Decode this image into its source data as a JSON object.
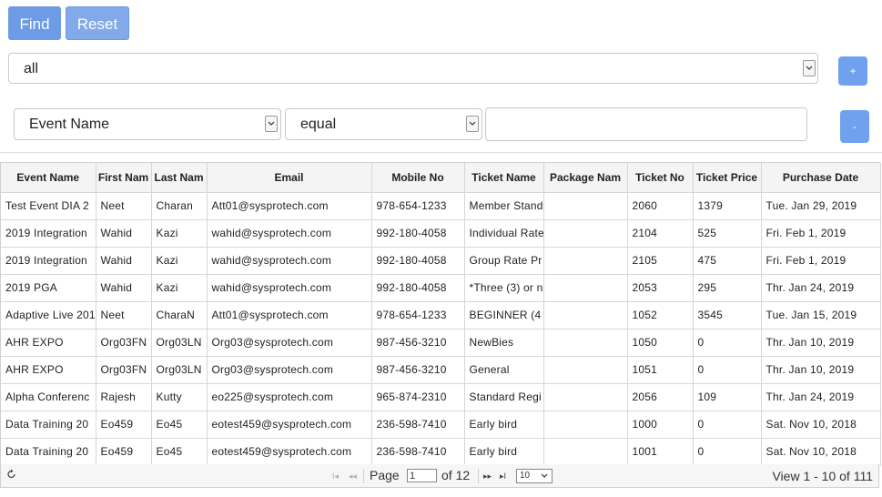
{
  "toolbar": {
    "find_label": "Find",
    "reset_label": "Reset",
    "plus_label": "+",
    "minus_label": "-"
  },
  "filter": {
    "group_value": "all",
    "field_value": "Event Name",
    "operator_value": "equal",
    "search_value": ""
  },
  "table": {
    "headers": [
      "Event Name",
      "First Nam",
      "Last Nam",
      "Email",
      "Mobile No",
      "Ticket Name",
      "Package Nam",
      "Ticket No",
      "Ticket Price",
      "Purchase Date"
    ],
    "rows": [
      [
        "Test Event DIA 2",
        "Neet",
        "Charan",
        "Att01@sysprotech.com",
        "978-654-1233",
        "Member Stand",
        "",
        "2060",
        "1379",
        "Tue. Jan 29, 2019"
      ],
      [
        "2019 Integration",
        "Wahid",
        "Kazi",
        "wahid@sysprotech.com",
        "992-180-4058",
        "Individual Rate",
        "",
        "2104",
        "525",
        "Fri. Feb 1, 2019"
      ],
      [
        "2019 Integration",
        "Wahid",
        "Kazi",
        "wahid@sysprotech.com",
        "992-180-4058",
        "Group Rate Pr",
        "",
        "2105",
        "475",
        "Fri. Feb 1, 2019"
      ],
      [
        "2019 PGA",
        "Wahid",
        "Kazi",
        "wahid@sysprotech.com",
        "992-180-4058",
        "*Three (3) or n",
        "",
        "2053",
        "295",
        "Thr. Jan 24, 2019"
      ],
      [
        "Adaptive Live 201",
        "Neet",
        "CharaN",
        "Att01@sysprotech.com",
        "978-654-1233",
        "BEGINNER (4",
        "",
        "1052",
        "3545",
        "Tue. Jan 15, 2019"
      ],
      [
        "AHR EXPO",
        "Org03FN",
        "Org03LN",
        "Org03@sysprotech.com",
        "987-456-3210",
        "NewBies",
        "",
        "1050",
        "0",
        "Thr. Jan 10, 2019"
      ],
      [
        "AHR EXPO",
        "Org03FN",
        "Org03LN",
        "Org03@sysprotech.com",
        "987-456-3210",
        "General",
        "",
        "1051",
        "0",
        "Thr. Jan 10, 2019"
      ],
      [
        "Alpha Conferenc",
        "Rajesh",
        "Kutty",
        "eo225@sysprotech.com",
        "965-874-2310",
        "Standard Regi",
        "",
        "2056",
        "109",
        "Thr. Jan 24, 2019"
      ],
      [
        "Data Training 20",
        "Eo459",
        "Eo45",
        "eotest459@sysprotech.com",
        "236-598-7410",
        "Early bird",
        "",
        "1000",
        "0",
        "Sat. Nov 10, 2018"
      ],
      [
        "Data Training 20",
        "Eo459",
        "Eo45",
        "eotest459@sysprotech.com",
        "236-598-7410",
        "Early bird",
        "",
        "1001",
        "0",
        "Sat. Nov 10, 2018"
      ]
    ]
  },
  "pager": {
    "refresh_icon": "refresh-icon",
    "page_prefix": "Page",
    "page_value": "1",
    "page_suffix": "of 12",
    "rows_value": "10",
    "view_text": "View 1 - 10 of 111"
  }
}
